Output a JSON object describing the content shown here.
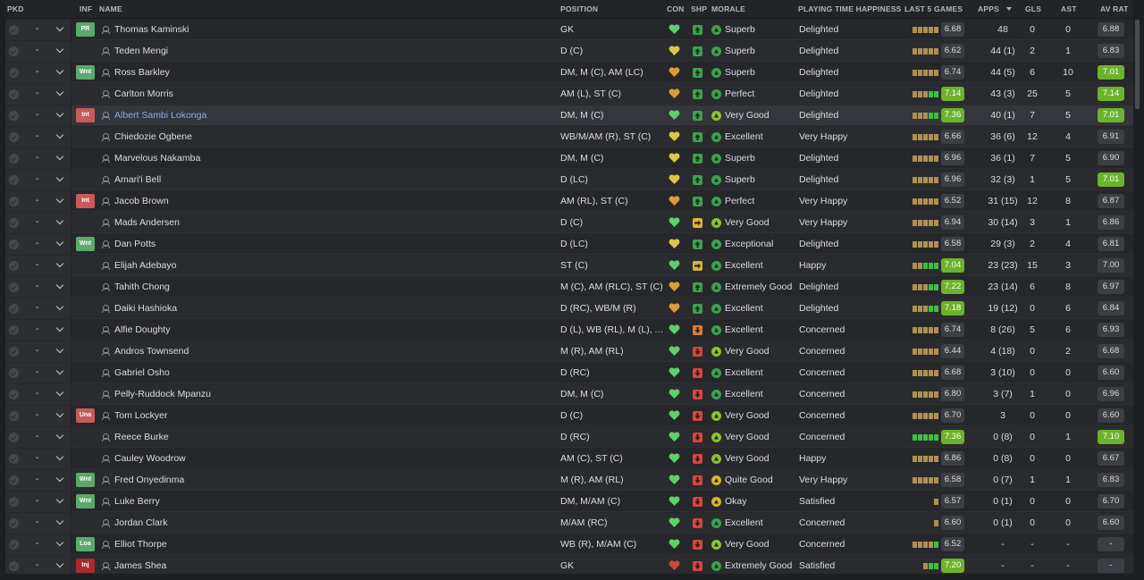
{
  "columns": {
    "pkd": "PKD",
    "inf": "INF",
    "name": "NAME",
    "position": "POSITION",
    "con": "CON",
    "shp": "SHP",
    "morale": "MORALE",
    "pth": "PLAYING TIME HAPPINESS",
    "last5": "LAST 5 GAMES",
    "apps": "APPS",
    "gls": "GLS",
    "ast": "AST",
    "avrat": "AV RAT"
  },
  "sort": {
    "column": "apps",
    "direction": "desc"
  },
  "colors": {
    "accent_green": "#6bb32b",
    "accent_red": "#c85a5a",
    "link_blue": "#7fb0e8",
    "con_green": "#5fd06a",
    "con_yellow": "#d9c84a",
    "con_orange": "#e09a3a",
    "con_red": "#c84a3a",
    "morale_green": "#3aa34a",
    "morale_lime": "#8ac42a",
    "morale_yellow": "#d9b52a",
    "shp_green": "#3aa34a",
    "shp_yellow": "#d9b52a",
    "shp_orange": "#e07a2a",
    "shp_red": "#d9453a",
    "form_tan": "#b19150",
    "form_green": "#3fbf3f"
  },
  "players": [
    {
      "pkd": "-",
      "inf": "PR",
      "inf_color": "green",
      "name": "Thomas Kaminski",
      "position": "GK",
      "con": "green",
      "shp": "green",
      "shp_icon": "arrow-up-icon",
      "morale_icon": "green",
      "morale": "Superb",
      "pth": "Delighted",
      "last5_count": 5,
      "last5_green": 0,
      "last5": "6.68",
      "last5_hi": false,
      "apps": "48",
      "gls": "0",
      "ast": "0",
      "avrat": "6.88",
      "avrat_hi": false
    },
    {
      "pkd": "-",
      "inf": "",
      "inf_color": "",
      "name": "Teden Mengi",
      "position": "D (C)",
      "con": "yellow",
      "shp": "green",
      "shp_icon": "arrow-up-icon",
      "morale_icon": "green",
      "morale": "Superb",
      "pth": "Delighted",
      "last5_count": 5,
      "last5_green": 0,
      "last5": "6.62",
      "last5_hi": false,
      "apps": "44 (1)",
      "gls": "2",
      "ast": "1",
      "avrat": "6.83",
      "avrat_hi": false
    },
    {
      "pkd": "-",
      "inf": "Wnt",
      "inf_color": "green",
      "name": "Ross Barkley",
      "position": "DM, M (C), AM (LC)",
      "con": "orange",
      "shp": "green",
      "shp_icon": "arrow-up-icon",
      "morale_icon": "green",
      "morale": "Superb",
      "pth": "Delighted",
      "last5_count": 5,
      "last5_green": 0,
      "last5": "6.74",
      "last5_hi": false,
      "apps": "44 (5)",
      "gls": "6",
      "ast": "10",
      "avrat": "7.01",
      "avrat_hi": true
    },
    {
      "pkd": "-",
      "inf": "",
      "inf_color": "",
      "name": "Carlton Morris",
      "position": "AM (L), ST (C)",
      "con": "orange",
      "shp": "green",
      "shp_icon": "arrow-up-icon",
      "morale_icon": "green",
      "morale": "Perfect",
      "pth": "Delighted",
      "last5_count": 5,
      "last5_green": 2,
      "last5": "7.14",
      "last5_hi": true,
      "apps": "43 (3)",
      "gls": "25",
      "ast": "5",
      "avrat": "7.14",
      "avrat_hi": true
    },
    {
      "pkd": "-",
      "inf": "Int",
      "inf_color": "red",
      "name": "Albert Sambi Lokonga",
      "position": "DM, M (C)",
      "con": "green",
      "shp": "green",
      "shp_icon": "arrow-up-icon",
      "morale_icon": "lime",
      "morale": "Very Good",
      "pth": "Delighted",
      "last5_count": 5,
      "last5_green": 2,
      "last5": "7.36",
      "last5_hi": true,
      "apps": "40 (1)",
      "gls": "7",
      "ast": "5",
      "avrat": "7.01",
      "avrat_hi": true,
      "selected": true
    },
    {
      "pkd": "-",
      "inf": "",
      "inf_color": "",
      "name": "Chiedozie Ogbene",
      "position": "WB/M/AM (R), ST (C)",
      "con": "yellow",
      "shp": "green",
      "shp_icon": "arrow-up-icon",
      "morale_icon": "green",
      "morale": "Excellent",
      "pth": "Very Happy",
      "last5_count": 5,
      "last5_green": 0,
      "last5": "6.66",
      "last5_hi": false,
      "apps": "36 (6)",
      "gls": "12",
      "ast": "4",
      "avrat": "6.91",
      "avrat_hi": false
    },
    {
      "pkd": "-",
      "inf": "",
      "inf_color": "",
      "name": "Marvelous Nakamba",
      "position": "DM, M (C)",
      "con": "yellow",
      "shp": "green",
      "shp_icon": "arrow-up-icon",
      "morale_icon": "green",
      "morale": "Superb",
      "pth": "Delighted",
      "last5_count": 5,
      "last5_green": 0,
      "last5": "6.96",
      "last5_hi": false,
      "apps": "36 (1)",
      "gls": "7",
      "ast": "5",
      "avrat": "6.90",
      "avrat_hi": false
    },
    {
      "pkd": "-",
      "inf": "",
      "inf_color": "",
      "name": "Amari'i Bell",
      "position": "D (LC)",
      "con": "yellow",
      "shp": "green",
      "shp_icon": "arrow-up-icon",
      "morale_icon": "green",
      "morale": "Superb",
      "pth": "Delighted",
      "last5_count": 5,
      "last5_green": 0,
      "last5": "6.96",
      "last5_hi": false,
      "apps": "32 (3)",
      "gls": "1",
      "ast": "5",
      "avrat": "7.01",
      "avrat_hi": true
    },
    {
      "pkd": "-",
      "inf": "Int",
      "inf_color": "red",
      "name": "Jacob Brown",
      "position": "AM (RL), ST (C)",
      "con": "orange",
      "shp": "green",
      "shp_icon": "arrow-up-icon",
      "morale_icon": "green",
      "morale": "Perfect",
      "pth": "Very Happy",
      "last5_count": 5,
      "last5_green": 0,
      "last5": "6.52",
      "last5_hi": false,
      "apps": "31 (15)",
      "gls": "12",
      "ast": "8",
      "avrat": "6.87",
      "avrat_hi": false
    },
    {
      "pkd": "-",
      "inf": "",
      "inf_color": "",
      "name": "Mads Andersen",
      "position": "D (C)",
      "con": "green",
      "shp": "yellow",
      "shp_icon": "arrow-side-icon",
      "morale_icon": "lime",
      "morale": "Very Good",
      "pth": "Very Happy",
      "last5_count": 5,
      "last5_green": 0,
      "last5": "6.94",
      "last5_hi": false,
      "apps": "30 (14)",
      "gls": "3",
      "ast": "1",
      "avrat": "6.86",
      "avrat_hi": false
    },
    {
      "pkd": "-",
      "inf": "Wnt",
      "inf_color": "green",
      "name": "Dan Potts",
      "position": "D (LC)",
      "con": "yellow",
      "shp": "green",
      "shp_icon": "arrow-up-icon",
      "morale_icon": "green",
      "morale": "Exceptional",
      "pth": "Delighted",
      "last5_count": 5,
      "last5_green": 0,
      "last5": "6.58",
      "last5_hi": false,
      "apps": "29 (3)",
      "gls": "2",
      "ast": "4",
      "avrat": "6.81",
      "avrat_hi": false
    },
    {
      "pkd": "-",
      "inf": "",
      "inf_color": "",
      "name": "Elijah Adebayo",
      "position": "ST (C)",
      "con": "green",
      "shp": "yellow",
      "shp_icon": "arrow-side-icon",
      "morale_icon": "green",
      "morale": "Excellent",
      "pth": "Happy",
      "last5_count": 5,
      "last5_green": 3,
      "last5": "7.04",
      "last5_hi": true,
      "apps": "23 (23)",
      "gls": "15",
      "ast": "3",
      "avrat": "7.00",
      "avrat_hi": false
    },
    {
      "pkd": "-",
      "inf": "",
      "inf_color": "",
      "name": "Tahith Chong",
      "position": "M (C), AM (RLC), ST (C)",
      "con": "orange",
      "shp": "green",
      "shp_icon": "arrow-up-icon",
      "morale_icon": "green",
      "morale": "Extremely Good",
      "pth": "Delighted",
      "last5_count": 5,
      "last5_green": 2,
      "last5": "7.22",
      "last5_hi": true,
      "apps": "23 (14)",
      "gls": "6",
      "ast": "8",
      "avrat": "6.97",
      "avrat_hi": false
    },
    {
      "pkd": "-",
      "inf": "",
      "inf_color": "",
      "name": "Daiki Hashioka",
      "position": "D (RC), WB/M (R)",
      "con": "orange",
      "shp": "green",
      "shp_icon": "arrow-up-icon",
      "morale_icon": "green",
      "morale": "Excellent",
      "pth": "Delighted",
      "last5_count": 5,
      "last5_green": 2,
      "last5": "7.18",
      "last5_hi": true,
      "apps": "19 (12)",
      "gls": "0",
      "ast": "6",
      "avrat": "6.84",
      "avrat_hi": false
    },
    {
      "pkd": "-",
      "inf": "",
      "inf_color": "",
      "name": "Alfie Doughty",
      "position": "D (L), WB (RL), M (L), AM (L)",
      "con": "green",
      "shp": "orange",
      "shp_icon": "arrow-down-icon",
      "morale_icon": "green",
      "morale": "Excellent",
      "pth": "Concerned",
      "last5_count": 5,
      "last5_green": 0,
      "last5": "6.74",
      "last5_hi": false,
      "apps": "8 (26)",
      "gls": "5",
      "ast": "6",
      "avrat": "6.93",
      "avrat_hi": false
    },
    {
      "pkd": "-",
      "inf": "",
      "inf_color": "",
      "name": "Andros Townsend",
      "position": "M (R), AM (RL)",
      "con": "green",
      "shp": "red",
      "shp_icon": "arrow-down-icon",
      "morale_icon": "lime",
      "morale": "Very Good",
      "pth": "Concerned",
      "last5_count": 5,
      "last5_green": 0,
      "last5": "6.44",
      "last5_hi": false,
      "apps": "4 (18)",
      "gls": "0",
      "ast": "2",
      "avrat": "6.68",
      "avrat_hi": false
    },
    {
      "pkd": "-",
      "inf": "",
      "inf_color": "",
      "name": "Gabriel Osho",
      "position": "D (RC)",
      "con": "green",
      "shp": "red",
      "shp_icon": "arrow-down-icon",
      "morale_icon": "green",
      "morale": "Excellent",
      "pth": "Concerned",
      "last5_count": 5,
      "last5_green": 0,
      "last5": "6.68",
      "last5_hi": false,
      "apps": "3 (10)",
      "gls": "0",
      "ast": "0",
      "avrat": "6.60",
      "avrat_hi": false
    },
    {
      "pkd": "-",
      "inf": "",
      "inf_color": "",
      "name": "Pelly-Ruddock Mpanzu",
      "position": "DM, M (C)",
      "con": "green",
      "shp": "red",
      "shp_icon": "arrow-down-icon",
      "morale_icon": "green",
      "morale": "Excellent",
      "pth": "Concerned",
      "last5_count": 5,
      "last5_green": 0,
      "last5": "6.80",
      "last5_hi": false,
      "apps": "3 (7)",
      "gls": "1",
      "ast": "0",
      "avrat": "6.96",
      "avrat_hi": false
    },
    {
      "pkd": "-",
      "inf": "Una",
      "inf_color": "red",
      "name": "Tom Lockyer",
      "position": "D (C)",
      "con": "green",
      "shp": "red",
      "shp_icon": "arrow-down-icon",
      "morale_icon": "lime",
      "morale": "Very Good",
      "pth": "Concerned",
      "last5_count": 5,
      "last5_green": 0,
      "last5": "6.70",
      "last5_hi": false,
      "apps": "3",
      "gls": "0",
      "ast": "0",
      "avrat": "6.60",
      "avrat_hi": false
    },
    {
      "pkd": "-",
      "inf": "",
      "inf_color": "",
      "name": "Reece Burke",
      "position": "D (RC)",
      "con": "green",
      "shp": "red",
      "shp_icon": "arrow-down-icon",
      "morale_icon": "lime",
      "morale": "Very Good",
      "pth": "Concerned",
      "last5_count": 5,
      "last5_green": 5,
      "last5": "7.36",
      "last5_hi": true,
      "apps": "0 (8)",
      "gls": "0",
      "ast": "1",
      "avrat": "7.10",
      "avrat_hi": true
    },
    {
      "pkd": "-",
      "inf": "",
      "inf_color": "",
      "name": "Cauley Woodrow",
      "position": "AM (C), ST (C)",
      "con": "green",
      "shp": "red",
      "shp_icon": "arrow-down-icon",
      "morale_icon": "lime",
      "morale": "Very Good",
      "pth": "Happy",
      "last5_count": 5,
      "last5_green": 0,
      "last5": "6.86",
      "last5_hi": false,
      "apps": "0 (8)",
      "gls": "0",
      "ast": "0",
      "avrat": "6.67",
      "avrat_hi": false
    },
    {
      "pkd": "-",
      "inf": "Wnt",
      "inf_color": "green",
      "name": "Fred Onyedinma",
      "position": "M (R), AM (RL)",
      "con": "green",
      "shp": "red",
      "shp_icon": "arrow-down-icon",
      "morale_icon": "yellow",
      "morale": "Quite Good",
      "pth": "Very Happy",
      "last5_count": 5,
      "last5_green": 0,
      "last5": "6.58",
      "last5_hi": false,
      "apps": "0 (7)",
      "gls": "1",
      "ast": "1",
      "avrat": "6.83",
      "avrat_hi": false
    },
    {
      "pkd": "-",
      "inf": "Wnt",
      "inf_color": "green",
      "name": "Luke Berry",
      "position": "DM, M/AM (C)",
      "con": "green",
      "shp": "red",
      "shp_icon": "arrow-down-icon",
      "morale_icon": "yellow",
      "morale": "Okay",
      "pth": "Satisfied",
      "last5_count": 1,
      "last5_green": 0,
      "last5": "6.57",
      "last5_hi": false,
      "apps": "0 (1)",
      "gls": "0",
      "ast": "0",
      "avrat": "6.70",
      "avrat_hi": false
    },
    {
      "pkd": "-",
      "inf": "",
      "inf_color": "",
      "name": "Jordan Clark",
      "position": "M/AM (RC)",
      "con": "green",
      "shp": "red",
      "shp_icon": "arrow-down-icon",
      "morale_icon": "green",
      "morale": "Excellent",
      "pth": "Concerned",
      "last5_count": 1,
      "last5_green": 0,
      "last5": "6.60",
      "last5_hi": false,
      "apps": "0 (1)",
      "gls": "0",
      "ast": "0",
      "avrat": "6.60",
      "avrat_hi": false
    },
    {
      "pkd": "-",
      "inf": "Loa",
      "inf_color": "green",
      "name": "Elliot Thorpe",
      "position": "WB (R), M/AM (C)",
      "con": "green",
      "shp": "red",
      "shp_icon": "arrow-down-icon",
      "morale_icon": "lime",
      "morale": "Very Good",
      "pth": "Concerned",
      "last5_count": 5,
      "last5_green": 1,
      "last5": "6.52",
      "last5_hi": false,
      "apps": "-",
      "gls": "-",
      "ast": "-",
      "avrat": "-",
      "avrat_hi": false
    },
    {
      "pkd": "-",
      "inf": "Inj",
      "inf_color": "dkred",
      "name": "James Shea",
      "position": "GK",
      "con": "red",
      "shp": "red",
      "shp_icon": "arrow-down-icon",
      "morale_icon": "green",
      "morale": "Extremely Good",
      "pth": "Satisfied",
      "last5_count": 3,
      "last5_green": 2,
      "last5": "7.20",
      "last5_hi": true,
      "apps": "-",
      "gls": "-",
      "ast": "-",
      "avrat": "-",
      "avrat_hi": false
    }
  ]
}
